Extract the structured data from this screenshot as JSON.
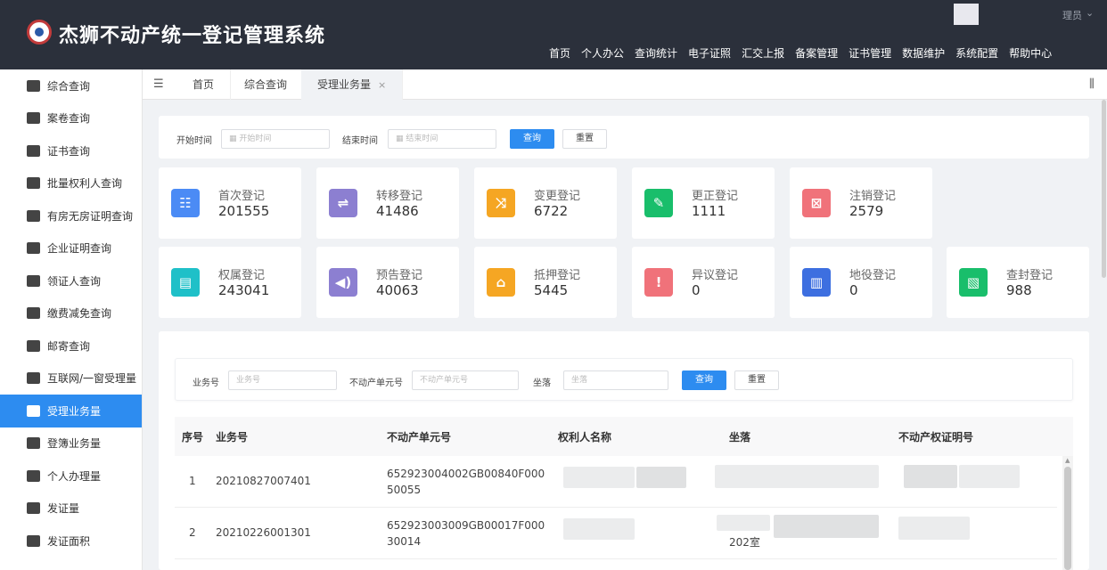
{
  "header": {
    "title": "杰狮不动产统一登记管理系统",
    "user_name": "理员",
    "nav": [
      "首页",
      "个人办公",
      "查询统计",
      "电子证照",
      "汇交上报",
      "备案管理",
      "证书管理",
      "数据维护",
      "系统配置",
      "帮助中心"
    ]
  },
  "sidebar": {
    "items": [
      {
        "label": "综合查询",
        "icon": "grid-search-icon"
      },
      {
        "label": "案卷查询",
        "icon": "archive-icon"
      },
      {
        "label": "证书查询",
        "icon": "certificate-icon"
      },
      {
        "label": "批量权利人查询",
        "icon": "person-icon"
      },
      {
        "label": "有房无房证明查询",
        "icon": "house-icon"
      },
      {
        "label": "企业证明查询",
        "icon": "building-icon"
      },
      {
        "label": "领证人查询",
        "icon": "id-card-icon"
      },
      {
        "label": "缴费减免查询",
        "icon": "fee-icon"
      },
      {
        "label": "邮寄查询",
        "icon": "mail-icon"
      },
      {
        "label": "互联网/一窗受理量",
        "icon": "window-icon"
      },
      {
        "label": "受理业务量",
        "icon": "accept-icon"
      },
      {
        "label": "登簿业务量",
        "icon": "register-icon"
      },
      {
        "label": "个人办理量",
        "icon": "user-stat-icon"
      },
      {
        "label": "发证量",
        "icon": "issue-icon"
      },
      {
        "label": "发证面积",
        "icon": "area-icon"
      }
    ],
    "active_index": 10
  },
  "tabs": {
    "items": [
      {
        "label": "首页"
      },
      {
        "label": "综合查询"
      },
      {
        "label": "受理业务量",
        "closable": true
      }
    ],
    "active_index": 2,
    "close_glyph": "×"
  },
  "filter_top": {
    "start_label": "开始时间",
    "start_placeholder": "开始时间",
    "end_label": "结束时间",
    "end_placeholder": "结束时间",
    "query_button": "查询",
    "reset_button": "重置"
  },
  "stats": [
    {
      "title": "首次登记",
      "value": "201555",
      "color": "#4b8bf5",
      "icon": "first-register-icon",
      "glyph": "☷"
    },
    {
      "title": "转移登记",
      "value": "41486",
      "color": "#8c7fd1",
      "icon": "transfer-icon",
      "glyph": "⇌"
    },
    {
      "title": "变更登记",
      "value": "6722",
      "color": "#f5a623",
      "icon": "shuffle-icon",
      "glyph": "⤨"
    },
    {
      "title": "更正登记",
      "value": "1111",
      "color": "#19be6b",
      "icon": "edit-icon",
      "glyph": "✎"
    },
    {
      "title": "注销登记",
      "value": "2579",
      "color": "#f0727a",
      "icon": "cancel-doc-icon",
      "glyph": "⊠"
    },
    {
      "title": "权属登记",
      "value": "243041",
      "color": "#1fc0c8",
      "icon": "ownership-icon",
      "glyph": "▤"
    },
    {
      "title": "预告登记",
      "value": "40063",
      "color": "#8c7fd1",
      "icon": "speaker-icon",
      "glyph": "◀)"
    },
    {
      "title": "抵押登记",
      "value": "5445",
      "color": "#f5a623",
      "icon": "home-icon",
      "glyph": "⌂"
    },
    {
      "title": "异议登记",
      "value": "0",
      "color": "#f0727a",
      "icon": "objection-icon",
      "glyph": "!"
    },
    {
      "title": "地役登记",
      "value": "0",
      "color": "#3d6fe0",
      "icon": "easement-icon",
      "glyph": "▥"
    },
    {
      "title": "查封登记",
      "value": "988",
      "color": "#19be6b",
      "icon": "seal-icon",
      "glyph": "▧"
    }
  ],
  "filter_bottom": {
    "biz_label": "业务号",
    "biz_placeholder": "业务号",
    "unit_label": "不动产单元号",
    "unit_placeholder": "不动产单元号",
    "loc_label": "坐落",
    "loc_placeholder": "坐落",
    "query_button": "查询",
    "reset_button": "重置"
  },
  "table": {
    "headers": [
      "序号",
      "业务号",
      "不动产单元号",
      "权利人名称",
      "坐落",
      "不动产权证明号"
    ],
    "rows": [
      {
        "index": "1",
        "biz_no": "20210827007401",
        "unit_no": "652923004002GB00840F00050055",
        "location": "",
        "cert_no": ""
      },
      {
        "index": "2",
        "biz_no": "20210226001301",
        "unit_no": "652923003009GB00017F00030014",
        "location": "202室",
        "cert_no": ""
      }
    ]
  }
}
